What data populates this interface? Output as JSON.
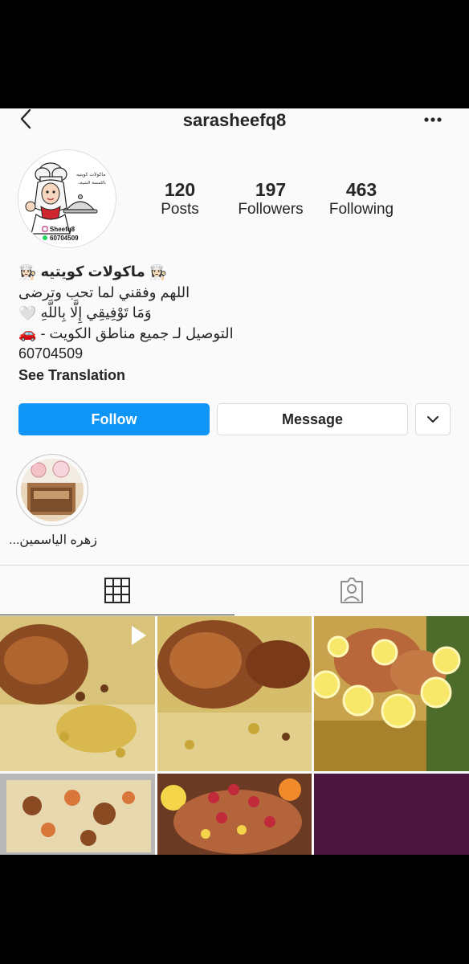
{
  "header": {
    "username": "sarasheefq8",
    "back_icon": "chevron-left-icon",
    "more_icon": "more-horizontal-icon"
  },
  "profile": {
    "avatar_logo_text": "Sheefq8",
    "avatar_phone": "60704509",
    "stats": [
      {
        "value": "120",
        "label": "Posts"
      },
      {
        "value": "197",
        "label": "Followers"
      },
      {
        "value": "463",
        "label": "Following"
      }
    ],
    "bio": {
      "name": "ماكولات كويتيه",
      "line1": "اللهم وفقني لما تحب وترضى",
      "line2": "وَمَا تَوْفِيقِي إِلَّا بِاللَّهِ",
      "line3": "التوصيل لـ جميع مناطق الكويت -",
      "phone": "60704509",
      "see_translation": "See Translation"
    }
  },
  "actions": {
    "follow": "Follow",
    "message": "Message",
    "dropdown_icon": "chevron-down-icon"
  },
  "highlights": [
    {
      "label": "زهره الياسمين..."
    }
  ],
  "tabs": [
    {
      "name": "grid",
      "icon": "grid-icon",
      "active": true
    },
    {
      "name": "tagged",
      "icon": "tagged-person-icon",
      "active": false
    }
  ],
  "colors": {
    "follow_blue": "#0f95f6",
    "background": "#fafafa",
    "text": "#262626",
    "border": "#dbdbdb"
  }
}
